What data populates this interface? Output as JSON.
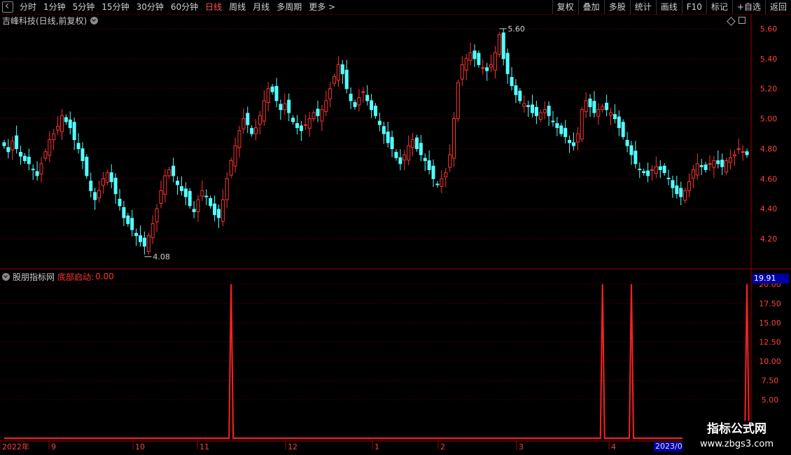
{
  "toolbar": {
    "periods": [
      "分时",
      "1分钟",
      "5分钟",
      "15分钟",
      "30分钟",
      "60分钟",
      "日线",
      "周线",
      "月线",
      "多周期",
      "更多 >"
    ],
    "active_period": "日线",
    "actions": [
      "复权",
      "叠加",
      "多股",
      "统计",
      "画线",
      "F10",
      "标记",
      "+自选",
      "返回"
    ]
  },
  "stock": {
    "title": "吉峰科技(日线,前复权)"
  },
  "indicator": {
    "source": "股朋指标网",
    "label": "底部启动:",
    "value": "0.00",
    "badge": "19.91"
  },
  "price_axis": {
    "ticks": [
      "5.60",
      "5.40",
      "5.20",
      "5.00",
      "4.80",
      "4.60",
      "4.40",
      "4.20"
    ]
  },
  "ind_axis": {
    "ticks": [
      "20.00",
      "17.50",
      "15.00",
      "12.50",
      "10.00",
      "7.50",
      "5.00"
    ]
  },
  "x_axis": {
    "labels": [
      "2022年",
      "9",
      "10",
      "11",
      "12",
      "1",
      "2",
      "3",
      "4"
    ],
    "date_badge": "2023/0"
  },
  "annotations": {
    "high": "5.60",
    "low": "4.08"
  },
  "watermark": {
    "title": "指标公式网",
    "url": "www.zbgs3.com"
  },
  "colors": {
    "up": "#ff3232",
    "down": "#54ffff",
    "grid": "#7a0000",
    "signal": "#ff2020"
  },
  "chart_data": {
    "type": "candlestick",
    "ylim": [
      4.08,
      5.6
    ],
    "close_series": [
      4.82,
      4.78,
      4.85,
      4.8,
      4.75,
      4.72,
      4.7,
      4.66,
      4.62,
      4.7,
      4.78,
      4.86,
      4.9,
      4.95,
      5.02,
      4.98,
      4.94,
      4.86,
      4.8,
      4.72,
      4.62,
      4.52,
      4.46,
      4.52,
      4.6,
      4.64,
      4.58,
      4.5,
      4.42,
      4.34,
      4.3,
      4.26,
      4.22,
      4.18,
      4.15,
      4.22,
      4.3,
      4.4,
      4.52,
      4.62,
      4.66,
      4.62,
      4.56,
      4.52,
      4.48,
      4.42,
      4.38,
      4.46,
      4.52,
      4.48,
      4.42,
      4.36,
      4.34,
      4.46,
      4.6,
      4.72,
      4.82,
      4.92,
      5.0,
      4.96,
      4.9,
      4.94,
      5.02,
      5.12,
      5.2,
      5.18,
      5.12,
      5.06,
      5.1,
      5.04,
      4.98,
      4.94,
      4.92,
      4.96,
      5.0,
      5.04,
      5.02,
      5.06,
      5.12,
      5.2,
      5.28,
      5.36,
      5.3,
      5.2,
      5.12,
      5.08,
      5.14,
      5.18,
      5.12,
      5.06,
      5.02,
      4.96,
      4.9,
      4.84,
      4.8,
      4.74,
      4.7,
      4.76,
      4.82,
      4.86,
      4.8,
      4.76,
      4.72,
      4.66,
      4.6,
      4.56,
      4.6,
      4.64,
      4.76,
      5.0,
      5.24,
      5.36,
      5.4,
      5.44,
      5.4,
      5.36,
      5.34,
      5.32,
      5.36,
      5.44,
      5.56,
      5.4,
      5.3,
      5.22,
      5.16,
      5.12,
      5.1,
      5.08,
      5.04,
      5.02,
      5.04,
      5.06,
      5.02,
      4.98,
      4.94,
      4.9,
      4.88,
      4.84,
      4.82,
      4.9,
      5.06,
      5.12,
      5.08,
      5.04,
      5.06,
      5.08,
      5.06,
      5.04,
      5.0,
      4.94,
      4.88,
      4.82,
      4.76,
      4.7,
      4.66,
      4.64,
      4.62,
      4.66,
      4.68,
      4.66,
      4.64,
      4.6,
      4.54,
      4.5,
      4.48,
      4.52,
      4.58,
      4.66,
      4.7,
      4.68,
      4.66,
      4.7,
      4.72,
      4.7,
      4.68,
      4.72,
      4.74,
      4.76,
      4.8,
      4.78,
      4.76
    ],
    "indicator_signals_index": [
      55,
      145,
      152,
      180,
      183,
      188,
      207,
      210,
      215
    ],
    "indicator_peak": 20.0
  }
}
